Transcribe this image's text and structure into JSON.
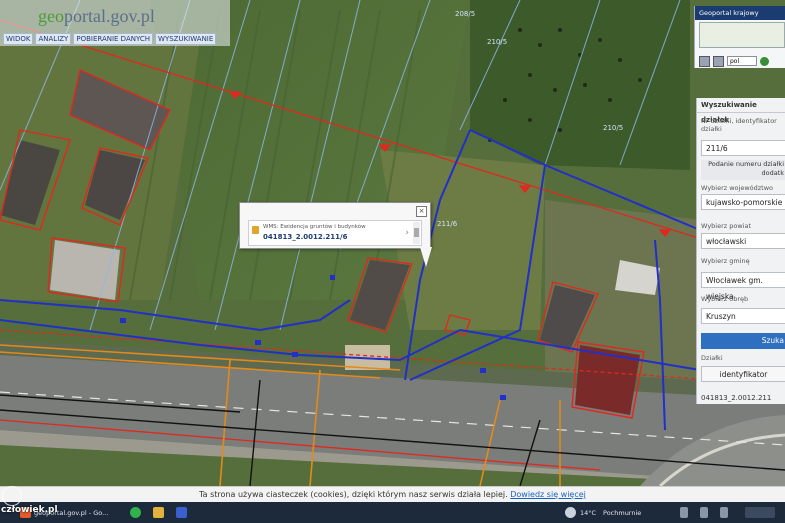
{
  "app": {
    "logo_prefix": "geo",
    "logo_rest": "portal.gov.pl"
  },
  "menu": [
    "WIDOK",
    "ANALIZY",
    "POBIERANIE DANYCH",
    "WYSZUKIWANIE"
  ],
  "mini_panel": {
    "title": "Geoportal krajowy",
    "language": "pol"
  },
  "search_panel": {
    "title": "Wyszukiwanie działek",
    "id_label": "Nr działki, identyfikator działki",
    "id_value": "211/6",
    "hint": "Podanie numeru działki dodatk",
    "voivodeship_label": "Wybierz województwo",
    "voivodeship_value": "kujawsko-pomorskie",
    "county_label": "Wybierz powiat",
    "county_value": "włocławski",
    "commune_label": "Wybierz gminę",
    "commune_value": "Włocławek gm. wiejska",
    "precinct_label": "Wybierz obręb",
    "precinct_value": "Kruszyn",
    "search_button": "Szuka",
    "parcels_label": "Działki",
    "parcels_column": "identyfikator",
    "parcel_result": "041813_2.0012.211"
  },
  "popup": {
    "layer": "WMS: Ewidencja gruntów i budynków",
    "parcel_id": "041813_2.0012.211/6",
    "close_glyph": "×",
    "next_glyph": "›"
  },
  "map_labels": {
    "parcel_top": "208/5",
    "parcel_mid": "210/5",
    "parcel_right": "210/5",
    "parcel_main": "211/6"
  },
  "cookie": {
    "text": "Ta strona używa ciasteczek (cookies), dzięki którym nasz serwis działa lepiej. ",
    "link": "Dowiedz się więcej"
  },
  "taskbar": {
    "window_title": "geoportal.gov.pl - Go...",
    "temperature": "14°C",
    "weather": "Pochmurnie"
  },
  "watermark": "człowiek.pl",
  "colors": {
    "parcel_red": "#e0281e",
    "parcel_blue": "#2030c8",
    "utility_orange": "#e38a1a",
    "panel_blue": "#1b3c70",
    "button_blue": "#2e6fc0"
  }
}
